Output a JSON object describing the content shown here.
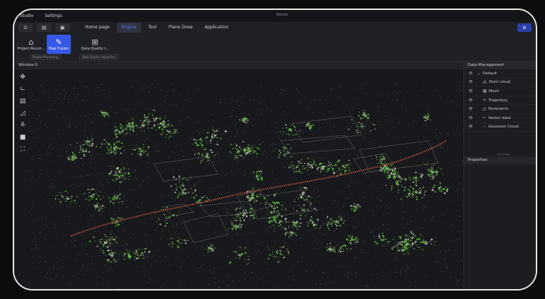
{
  "menu": {
    "items": [
      "Studio",
      "Settings"
    ],
    "window_title": "Stereo"
  },
  "quick_access": [
    "⊙",
    "▤",
    "▣"
  ],
  "tabs": [
    {
      "label": "Home page",
      "active": false
    },
    {
      "label": "Engine",
      "active": true
    },
    {
      "label": "Tool",
      "active": false
    },
    {
      "label": "Plane Draw",
      "active": false
    },
    {
      "label": "Application",
      "active": false
    }
  ],
  "ribbon": {
    "buttons": [
      {
        "label": "Project Recon...",
        "icon": "project-icon"
      },
      {
        "label": "Map Fusion",
        "icon": "map-fusion-icon",
        "active": true
      },
      {
        "label": "Data Quality I...",
        "icon": "quality-icon"
      }
    ],
    "groups": [
      "Project Processing",
      "Data Quality Inspection"
    ]
  },
  "viewport": {
    "title": "Window 0"
  },
  "data_management": {
    "title": "Data Management",
    "root": "Default",
    "items": [
      {
        "label": "Point cloud",
        "icon": "point-cloud-icon",
        "glyph": "⁂"
      },
      {
        "label": "Mesh",
        "icon": "mesh-icon",
        "glyph": "▦"
      },
      {
        "label": "Trajectory",
        "icon": "trajectory-icon",
        "glyph": "≈"
      },
      {
        "label": "Panoramic",
        "icon": "panoramic-icon",
        "glyph": "⊡"
      },
      {
        "label": "Vector data",
        "icon": "vector-icon",
        "glyph": "⌐"
      },
      {
        "label": "Gaussian Cloud",
        "icon": "gaussian-icon",
        "glyph": "⁘"
      }
    ]
  },
  "properties": {
    "title": "Properties"
  },
  "colors": {
    "accent": "#3658e8",
    "tab_active": "#5f7bff",
    "trajectory": "#e05a3a"
  }
}
